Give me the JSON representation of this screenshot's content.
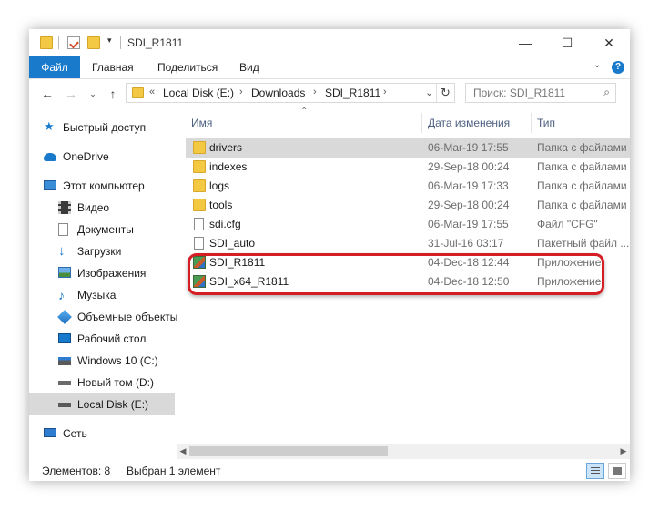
{
  "window": {
    "title": "SDI_R1811",
    "controls": {
      "minimize": "—",
      "maximize": "☐",
      "close": "✕"
    }
  },
  "ribbon": {
    "tabs": [
      "Файл",
      "Главная",
      "Поделиться",
      "Вид"
    ],
    "help": "?"
  },
  "address": {
    "crumbs": [
      "Local Disk (E:)",
      "Downloads",
      "SDI_R1811"
    ],
    "overflow": "«"
  },
  "search": {
    "placeholder": "Поиск: SDI_R1811"
  },
  "nav": {
    "items": [
      {
        "label": "Быстрый доступ",
        "icon": "star-icon"
      },
      {
        "label": "OneDrive",
        "icon": "cloud-icon"
      },
      {
        "label": "Этот компьютер",
        "icon": "computer-icon"
      },
      {
        "label": "Видео",
        "icon": "video-icon"
      },
      {
        "label": "Документы",
        "icon": "documents-icon"
      },
      {
        "label": "Загрузки",
        "icon": "download-icon"
      },
      {
        "label": "Изображения",
        "icon": "pictures-icon"
      },
      {
        "label": "Музыка",
        "icon": "music-icon"
      },
      {
        "label": "Объемные объекты",
        "icon": "3d-objects-icon"
      },
      {
        "label": "Рабочий стол",
        "icon": "desktop-icon"
      },
      {
        "label": "Windows 10 (C:)",
        "icon": "drive-icon"
      },
      {
        "label": "Новый том (D:)",
        "icon": "drive-icon"
      },
      {
        "label": "Local Disk (E:)",
        "icon": "drive-icon"
      },
      {
        "label": "Сеть",
        "icon": "network-icon"
      }
    ]
  },
  "columns": {
    "name": "Имя",
    "date": "Дата изменения",
    "type": "Тип"
  },
  "files": [
    {
      "name": "drivers",
      "date": "06-Mar-19 17:55",
      "type": "Папка с файлами",
      "kind": "folder"
    },
    {
      "name": "indexes",
      "date": "29-Sep-18 00:24",
      "type": "Папка с файлами",
      "kind": "folder"
    },
    {
      "name": "logs",
      "date": "06-Mar-19 17:33",
      "type": "Папка с файлами",
      "kind": "folder"
    },
    {
      "name": "tools",
      "date": "29-Sep-18 00:24",
      "type": "Папка с файлами",
      "kind": "folder"
    },
    {
      "name": "sdi.cfg",
      "date": "06-Mar-19 17:55",
      "type": "Файл \"CFG\"",
      "kind": "document"
    },
    {
      "name": "SDI_auto",
      "date": "31-Jul-16 03:17",
      "type": "Пакетный файл ...",
      "kind": "document"
    },
    {
      "name": "SDI_R1811",
      "date": "04-Dec-18 12:44",
      "type": "Приложение",
      "kind": "application"
    },
    {
      "name": "SDI_x64_R1811",
      "date": "04-Dec-18 12:50",
      "type": "Приложение",
      "kind": "application"
    }
  ],
  "status": {
    "count": "Элементов: 8",
    "selection": "Выбран 1 элемент"
  },
  "colors": {
    "accent": "#1979ca",
    "highlight": "#d41e24",
    "folder": "#f3c943"
  }
}
